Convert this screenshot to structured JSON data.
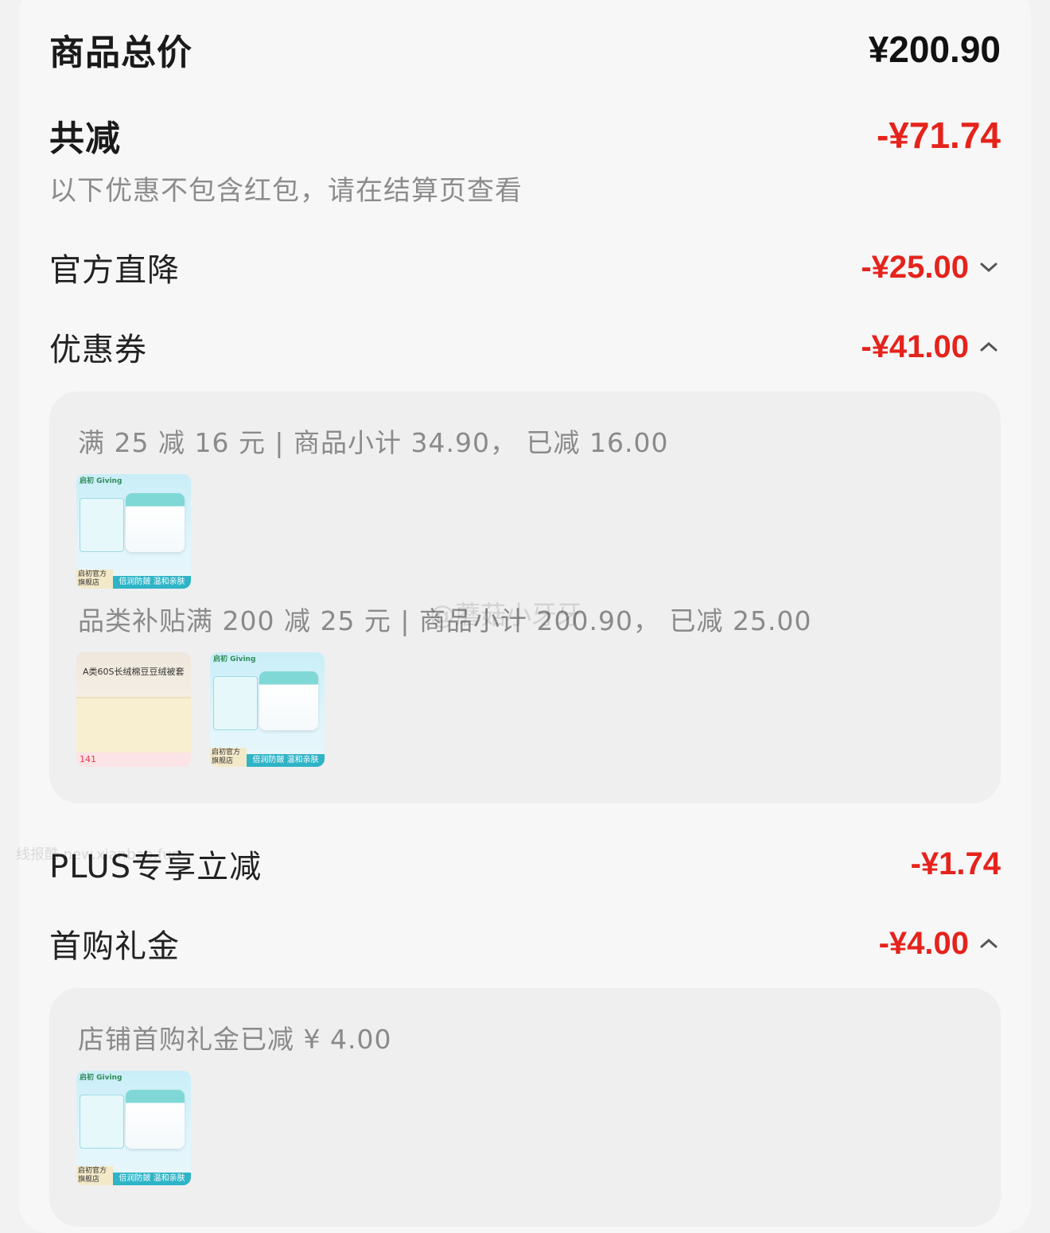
{
  "summary": {
    "total_label": "商品总价",
    "total_value": "¥200.90",
    "discount_label": "共减",
    "discount_value": "-¥71.74",
    "note": "以下优惠不包含红包，请在结算页查看"
  },
  "items": {
    "official": {
      "label": "官方直降",
      "value": "-¥25.00",
      "chevron": "chevron-down-icon"
    },
    "coupon": {
      "label": "优惠券",
      "value": "-¥41.00",
      "chevron": "chevron-up-icon"
    },
    "plus": {
      "label": "PLUS专享立减",
      "value": "-¥1.74"
    },
    "first": {
      "label": "首购礼金",
      "value": "-¥4.00",
      "chevron": "chevron-up-icon"
    }
  },
  "coupon_panel": {
    "line1": "满 25 减 16 元 | 商品小计 34.90， 已减 16.00",
    "line2": "品类补贴满 200 减 25 元 | 商品小计 200.90， 已减 25.00",
    "thumb_product": {
      "brand": "启初 Giving",
      "badge": "启初官方 旗舰店",
      "ribbon": "倍润防皴 温和亲肤"
    },
    "thumb_bedding": {
      "title": "A类60S长绒棉豆豆绒被套",
      "price": "141"
    }
  },
  "first_panel": {
    "line1": "店铺首购礼金已减 ¥ 4.00"
  },
  "watermarks": {
    "weibo": "@蘑菇小牙牙",
    "site": "线报酷 new.xianbao.fun"
  },
  "colors": {
    "accent_red": "#e5231c"
  }
}
